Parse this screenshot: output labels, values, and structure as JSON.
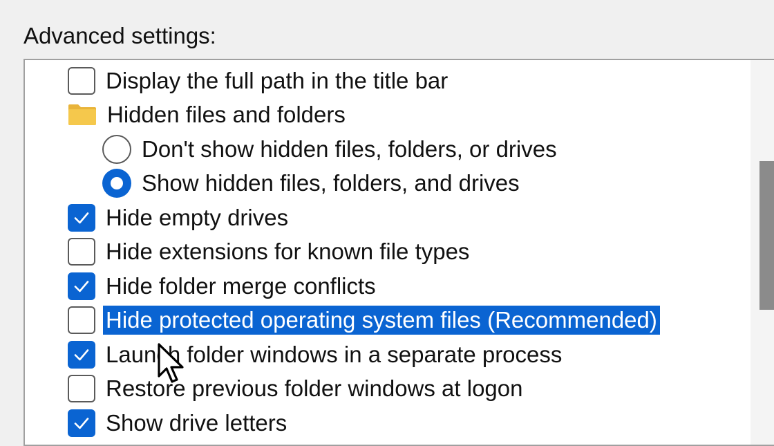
{
  "section_label": "Advanced settings:",
  "items": [
    {
      "kind": "checkbox",
      "checked": false,
      "level": 0,
      "label": "Display the full path in the title bar",
      "selected": false
    },
    {
      "kind": "folder",
      "icon": "folder-icon",
      "level": 0,
      "label": "Hidden files and folders",
      "selected": false
    },
    {
      "kind": "radio",
      "checked": false,
      "level": 1,
      "label": "Don't show hidden files, folders, or drives",
      "selected": false
    },
    {
      "kind": "radio",
      "checked": true,
      "level": 1,
      "label": "Show hidden files, folders, and drives",
      "selected": false
    },
    {
      "kind": "checkbox",
      "checked": true,
      "level": 0,
      "label": "Hide empty drives",
      "selected": false
    },
    {
      "kind": "checkbox",
      "checked": false,
      "level": 0,
      "label": "Hide extensions for known file types",
      "selected": false
    },
    {
      "kind": "checkbox",
      "checked": true,
      "level": 0,
      "label": "Hide folder merge conflicts",
      "selected": false
    },
    {
      "kind": "checkbox",
      "checked": false,
      "level": 0,
      "label": "Hide protected operating system files (Recommended)",
      "selected": true
    },
    {
      "kind": "checkbox",
      "checked": true,
      "level": 0,
      "label": "Launch folder windows in a separate process",
      "selected": false
    },
    {
      "kind": "checkbox",
      "checked": false,
      "level": 0,
      "label": "Restore previous folder windows at logon",
      "selected": false
    },
    {
      "kind": "checkbox",
      "checked": true,
      "level": 0,
      "label": "Show drive letters",
      "selected": false
    }
  ],
  "colors": {
    "accent": "#0a64d2",
    "selection_background": "#0a64d2",
    "selection_text": "#ffffff",
    "folder": "#f5c84c"
  }
}
